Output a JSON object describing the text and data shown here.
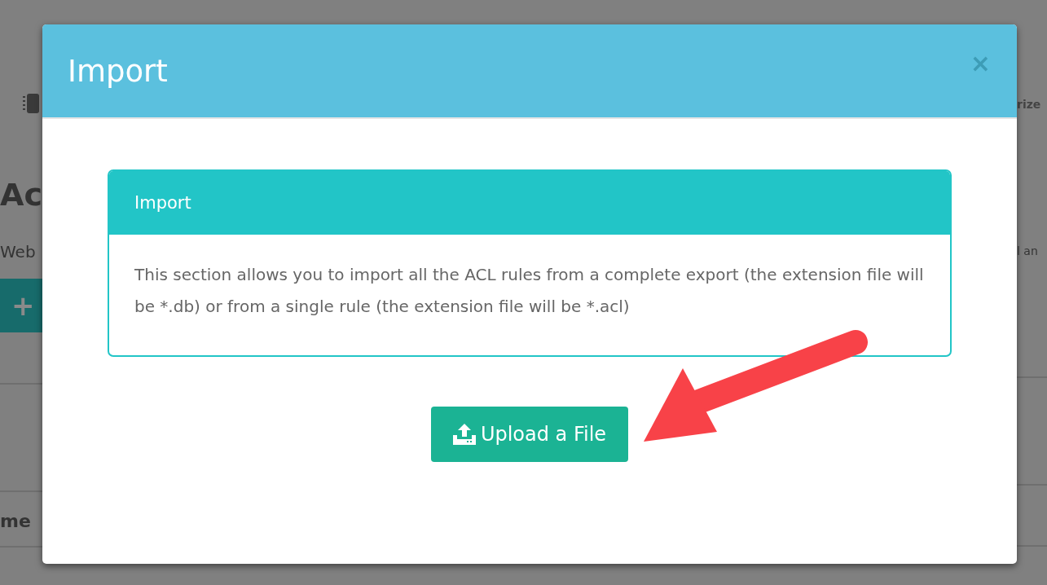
{
  "background_page": {
    "heading": "Ac",
    "subtitle": "Web",
    "button_symbol": "+",
    "table_column": "me",
    "toolbar_text": "rize",
    "subtitle_end": "l an"
  },
  "dialog": {
    "title": "Import",
    "close": "×",
    "panel": {
      "title": "Import",
      "text": "This section allows you to import all the ACL rules from a complete export (the extension file will be *.db) or from a single rule (the extension file will be *.acl)"
    },
    "upload_button": "Upload a File"
  }
}
